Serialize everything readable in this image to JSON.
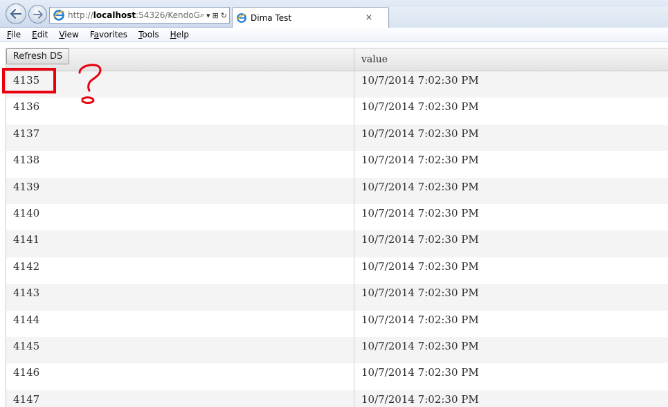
{
  "browser": {
    "address": {
      "prefix": "http://",
      "host": "localhost",
      "rest": ":54326/KendoG"
    },
    "tab": {
      "title": "Dima Test",
      "close": "×"
    },
    "address_tools": {
      "search": "⌕",
      "dropdown": "▾",
      "compat": "⊞",
      "refresh": "↻"
    }
  },
  "menu": {
    "items": [
      {
        "first": "F",
        "rest": "ile"
      },
      {
        "first": "E",
        "rest": "dit"
      },
      {
        "first": "V",
        "rest": "iew"
      },
      {
        "first": "F",
        "rest": "avorites",
        "underline_index": 1
      },
      {
        "first": "T",
        "rest": "ools"
      },
      {
        "first": "H",
        "rest": "elp"
      }
    ]
  },
  "toolbar": {
    "refresh_label": "Refresh DS"
  },
  "grid": {
    "columns": [
      {
        "title": ""
      },
      {
        "title": "value"
      }
    ],
    "rows": [
      {
        "id": "4135",
        "value": "10/7/2014 7:02:30 PM"
      },
      {
        "id": "4136",
        "value": "10/7/2014 7:02:30 PM"
      },
      {
        "id": "4137",
        "value": "10/7/2014 7:02:30 PM"
      },
      {
        "id": "4138",
        "value": "10/7/2014 7:02:30 PM"
      },
      {
        "id": "4139",
        "value": "10/7/2014 7:02:30 PM"
      },
      {
        "id": "4140",
        "value": "10/7/2014 7:02:30 PM"
      },
      {
        "id": "4141",
        "value": "10/7/2014 7:02:30 PM"
      },
      {
        "id": "4142",
        "value": "10/7/2014 7:02:30 PM"
      },
      {
        "id": "4143",
        "value": "10/7/2014 7:02:30 PM"
      },
      {
        "id": "4144",
        "value": "10/7/2014 7:02:30 PM"
      },
      {
        "id": "4145",
        "value": "10/7/2014 7:02:30 PM"
      },
      {
        "id": "4146",
        "value": "10/7/2014 7:02:30 PM"
      },
      {
        "id": "4147",
        "value": "10/7/2014 7:02:30 PM"
      }
    ]
  },
  "colors": {
    "annotation_red": "#e8000e",
    "row_alt": "#f4f4f4"
  }
}
